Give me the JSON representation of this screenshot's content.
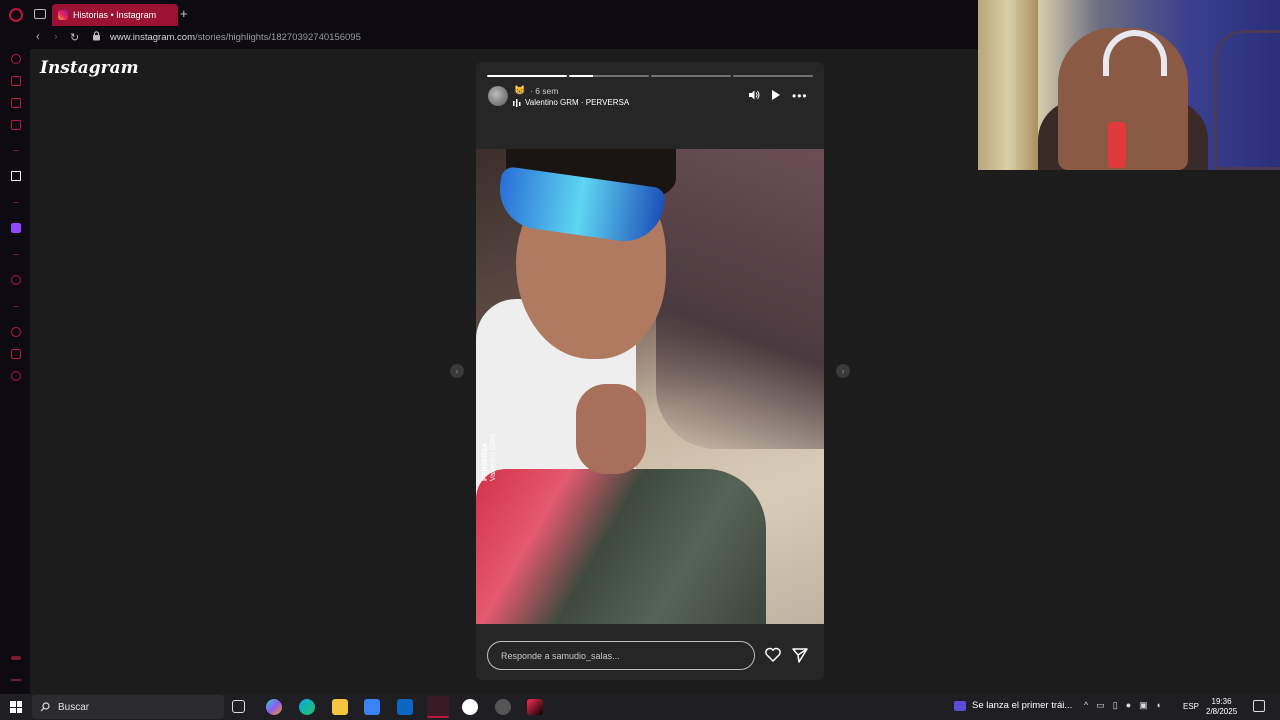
{
  "browser": {
    "tab_title": "Historias • Instagram",
    "new_tab_symbol": "+",
    "url_host": "www.instagram.com",
    "url_path": "/stories/highlights/18270392740156095",
    "back_symbol": "‹",
    "forward_symbol": "›",
    "reload_symbol": "↻"
  },
  "brand": {
    "logo_text": "Instagram"
  },
  "story": {
    "progress": {
      "segments": 4,
      "current_index": 1,
      "current_fraction": 0.3
    },
    "emoji": "😸",
    "time_ago": "· 6 sem",
    "music_text": "Valentino GRM · PERVERSA",
    "more_symbol": "•••",
    "watermark_line1": "PERVERSA",
    "watermark_line2": "Valentino GRM",
    "reply_placeholder": "Responde a samudio_salas...",
    "prev_symbol": "‹",
    "next_symbol": "›"
  },
  "taskbar": {
    "search_label": "Buscar",
    "news_text": "Se lanza el primer trái...",
    "language": "ESP",
    "time": "19:36",
    "date": "2/8/2025"
  },
  "colors": {
    "accent": "#c0153c",
    "tab_active": "#9b1233",
    "page_bg": "#1c1c1c",
    "story_bg": "#262626"
  }
}
